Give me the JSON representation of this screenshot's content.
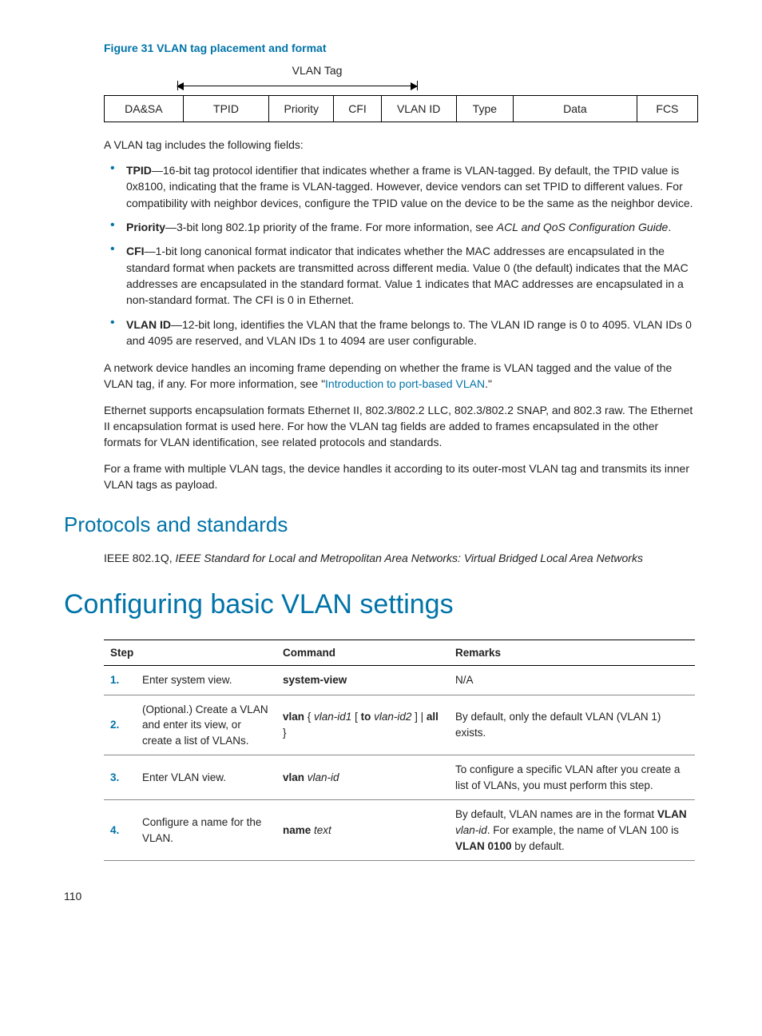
{
  "figure_caption": "Figure 31 VLAN tag placement and format",
  "diagram": {
    "tag_label": "VLAN Tag",
    "cells": [
      "DA&SA",
      "TPID",
      "Priority",
      "CFI",
      "VLAN ID",
      "Type",
      "Data",
      "FCS"
    ]
  },
  "intro": "A VLAN tag includes the following fields:",
  "fields": {
    "tpid": {
      "term": "TPID",
      "text": "—16-bit tag protocol identifier that indicates whether a frame is VLAN-tagged. By default, the TPID value is 0x8100, indicating that the frame is VLAN-tagged. However, device vendors can set TPID to different values. For compatibility with neighbor devices, configure the TPID value on the device to be the same as the neighbor device."
    },
    "priority": {
      "term": "Priority",
      "text_a": "—3-bit long 802.1p priority of the frame. For more information, see ",
      "ital": "ACL and QoS Configuration Guide",
      "text_b": "."
    },
    "cfi": {
      "term": "CFI",
      "text": "—1-bit long canonical format indicator that indicates whether the MAC addresses are encapsulated in the standard format when packets are transmitted across different media. Value 0 (the default) indicates that the MAC addresses are encapsulated in the standard format. Value 1 indicates that MAC addresses are encapsulated in a non-standard format. The CFI is 0 in Ethernet."
    },
    "vlanid": {
      "term": "VLAN ID",
      "text": "—12-bit long, identifies the VLAN that the frame belongs to. The VLAN ID range is 0 to 4095. VLAN IDs 0 and 4095 are reserved, and VLAN IDs 1 to 4094 are user configurable."
    }
  },
  "para1_a": "A network device handles an incoming frame depending on whether the frame is VLAN tagged and the value of the VLAN tag, if any. For more information, see \"",
  "para1_link": "Introduction to port-based VLAN",
  "para1_b": ".\"",
  "para2": "Ethernet supports encapsulation formats Ethernet II, 802.3/802.2 LLC, 802.3/802.2 SNAP, and 802.3 raw. The Ethernet II encapsulation format is used here. For how the VLAN tag fields are added to frames encapsulated in the other formats for VLAN identification, see related protocols and standards.",
  "para3": "For a frame with multiple VLAN tags, the device handles it according to its outer-most VLAN tag and transmits its inner VLAN tags as payload.",
  "protocols_heading": "Protocols and standards",
  "protocols_text_a": "IEEE 802.1Q, ",
  "protocols_text_ital": "IEEE Standard for Local and Metropolitan Area Networks: Virtual Bridged Local Area Networks",
  "config_heading": "Configuring basic VLAN settings",
  "table": {
    "headers": [
      "Step",
      "Command",
      "Remarks"
    ],
    "rows": [
      {
        "n": "1.",
        "step": "Enter system view.",
        "cmd_bold": "system-view",
        "remarks_plain": "N/A"
      },
      {
        "n": "2.",
        "step": "(Optional.) Create a VLAN and enter its view, or create a list of VLANs.",
        "cmd_parts": {
          "a": "vlan",
          "b": " { ",
          "c": "vlan-id1",
          "d": " [ ",
          "e": "to",
          "f": " ",
          "g": "vlan-id2",
          "h": " ] | ",
          "i": "all",
          "j": " }"
        },
        "remarks_plain": "By default, only the default VLAN (VLAN 1) exists."
      },
      {
        "n": "3.",
        "step": "Enter VLAN view.",
        "cmd3": {
          "a": "vlan",
          "b": " ",
          "c": "vlan-id"
        },
        "remarks_plain": "To configure a specific VLAN after you create a list of VLANs, you must perform this step."
      },
      {
        "n": "4.",
        "step": "Configure a name for the VLAN.",
        "cmd4": {
          "a": "name",
          "b": " ",
          "c": "text"
        },
        "remarks4": {
          "a": "By default, VLAN names are in the format ",
          "b": "VLAN",
          "c": " ",
          "d": "vlan-id",
          "e": ". For example, the name of VLAN 100 is ",
          "f": "VLAN 0100",
          "g": " by default."
        }
      }
    ]
  },
  "page_number": "110"
}
